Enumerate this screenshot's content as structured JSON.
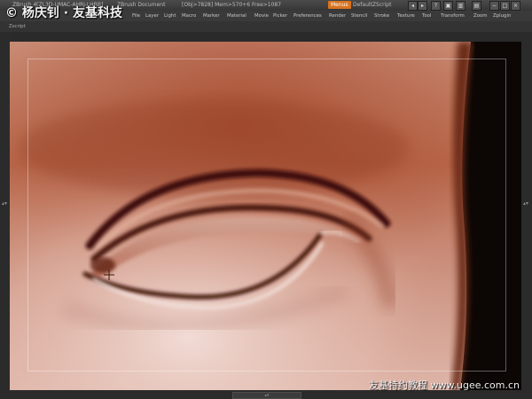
{
  "titlebar": {
    "app": "ZBrush  4[ZL3D-UMAC-AHRJ-LHRB]",
    "document": "ZBrush Document",
    "stats": "[Obj>7828]  Mem>570+6  Free>1087",
    "menus_label": "Menus",
    "script_label": "DefaultZScript"
  },
  "menubar": {
    "items": [
      "File",
      "Layer",
      "Light",
      "Macro",
      "Marker",
      "Material",
      "Movie",
      "Picker",
      "Preferences",
      "Render",
      "Stencil",
      "Stroke",
      "Texture",
      "Tool",
      "Transform",
      "Zoom",
      "Zplugin"
    ]
  },
  "scriptbar": {
    "label": "Zscript"
  },
  "watermark": {
    "text": "© 杨庆钊 · 友基科技"
  },
  "footer": {
    "text": "友基特约教程 www.ugee.com.cn"
  },
  "colors": {
    "skin_light": "#e9c4b4",
    "skin_mid": "#c27355",
    "skin_dark": "#8a3a22",
    "crease": "#4a1408",
    "menus_accent": "#d8731f"
  }
}
